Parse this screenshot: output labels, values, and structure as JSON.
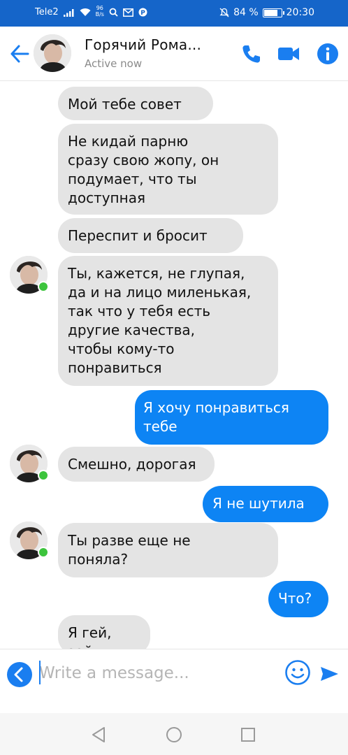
{
  "status_bar": {
    "carrier": "Tele2",
    "speed_value": "96",
    "speed_unit": "B/s",
    "battery_text": "84 %",
    "battery_level": 0.84,
    "time": "20:30"
  },
  "header": {
    "contact_name": "Горячий Рома...",
    "status": "Active now",
    "accent_color": "#1a7ef0"
  },
  "messages": [
    {
      "side": "incoming",
      "text": "Мой тебе совет"
    },
    {
      "side": "incoming",
      "text": "Не кидай парню\nсразу свою жопу, он\nподумает, что ты\nдоступная"
    },
    {
      "side": "incoming",
      "text": "Переспит и бросит"
    },
    {
      "side": "incoming",
      "text": "Ты, кажется, не глупая,\nда и на лицо миленькая,\nтак что у тебя есть\nдругие качества,\nчтобы кому-то\nпонравиться"
    },
    {
      "side": "outgoing",
      "text": "Я хочу понравиться\nтебе"
    },
    {
      "side": "incoming",
      "text": "Смешно, дорогая"
    },
    {
      "side": "outgoing",
      "text": "Я не шутила"
    },
    {
      "side": "incoming",
      "text": "Ты разве еще не\nпоняла?"
    },
    {
      "side": "outgoing",
      "text": "Что?"
    },
    {
      "side": "incoming",
      "text": "Я гей, зай"
    }
  ],
  "composer": {
    "placeholder": "Write a message..."
  },
  "colors": {
    "status_bar": "#1565c9",
    "outgoing_bubble": "#0d84f4",
    "incoming_bubble": "#e4e4e4",
    "online": "#3cc43c"
  },
  "icons": {
    "back": "arrow-left-icon",
    "call": "phone-icon",
    "video": "video-camera-icon",
    "info": "info-icon",
    "expand": "chevron-left-icon",
    "emoji": "smiley-icon",
    "send": "send-icon"
  }
}
